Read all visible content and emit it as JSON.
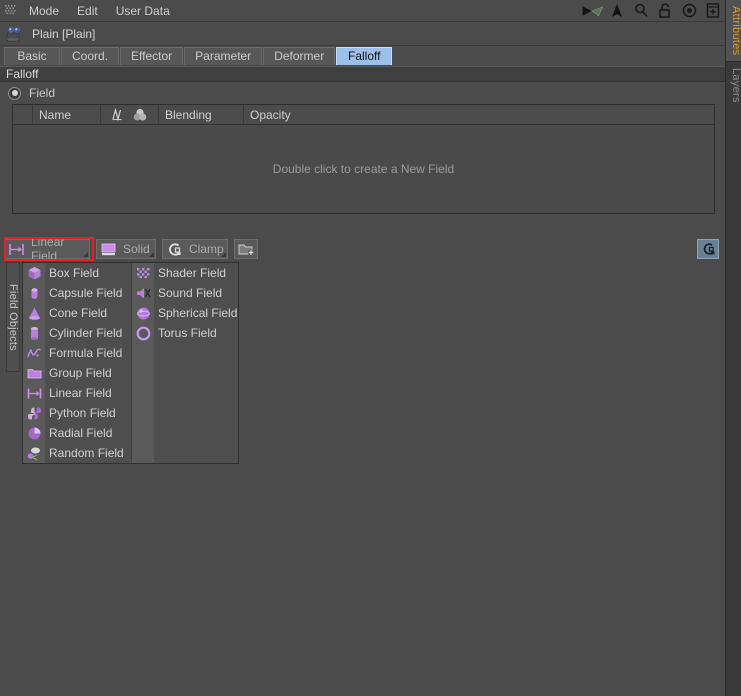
{
  "window": {
    "app": "Cinema 4D Attributes Manager",
    "background_color": "#4b4b4b",
    "accent_color": "#b07ad6",
    "highlight_color": "#ee1c25",
    "active_tab_color": "#9dc0ea"
  },
  "menubar": {
    "grip_icon": "grip-dots-icon",
    "items": [
      {
        "label": "Mode"
      },
      {
        "label": "Edit"
      },
      {
        "label": "User Data"
      }
    ],
    "tools": [
      {
        "name": "navigate-back-icon",
        "glyph": "◀"
      },
      {
        "name": "perspective-view-icon",
        "glyph": "▶"
      },
      {
        "name": "pointer-arrow-icon",
        "glyph": "▲"
      },
      {
        "name": "search-icon",
        "glyph": "⚲"
      },
      {
        "name": "lock-open-icon",
        "glyph": "⚿"
      },
      {
        "name": "target-icon",
        "glyph": "◎"
      },
      {
        "name": "new-panel-icon",
        "glyph": "⊞"
      }
    ]
  },
  "object": {
    "icon": "plain-effector-icon",
    "title": "Plain [Plain]"
  },
  "tabs": [
    {
      "label": "Basic",
      "active": false
    },
    {
      "label": "Coord.",
      "active": false
    },
    {
      "label": "Effector",
      "active": false
    },
    {
      "label": "Parameter",
      "active": false
    },
    {
      "label": "Deformer",
      "active": false
    },
    {
      "label": "Falloff",
      "active": true
    }
  ],
  "section": {
    "title": "Falloff",
    "field_row_label": "Field",
    "field_radio_icon": "radio-selected-icon"
  },
  "field_list": {
    "columns": [
      {
        "key": "enable",
        "label": ""
      },
      {
        "key": "name",
        "label": "Name"
      },
      {
        "key": "mode",
        "label": "",
        "icons": [
          "curve-icon",
          "color-blend-icon"
        ]
      },
      {
        "key": "blending",
        "label": "Blending"
      },
      {
        "key": "opacity",
        "label": "Opacity"
      }
    ],
    "rows": [],
    "empty_message": "Double click to create a New Field"
  },
  "toolbar": {
    "buttons": [
      {
        "label": "Linear Field",
        "icon": "linear-field-icon",
        "highlighted": true
      },
      {
        "label": "Solid",
        "icon": "solid-layer-icon",
        "highlighted": false
      },
      {
        "label": "Clamp",
        "icon": "clamp-layer-icon",
        "highlighted": false
      }
    ],
    "add_folder_icon": "add-folder-icon",
    "right_button_icon": "remap-icon"
  },
  "field_objects_strip": {
    "label": "Field Objects"
  },
  "popup_menu": {
    "left_column": [
      {
        "label": "Box Field",
        "icon": "box-field-icon"
      },
      {
        "label": "Capsule Field",
        "icon": "capsule-field-icon"
      },
      {
        "label": "Cone Field",
        "icon": "cone-field-icon"
      },
      {
        "label": "Cylinder Field",
        "icon": "cylinder-field-icon"
      },
      {
        "label": "Formula Field",
        "icon": "formula-field-icon"
      },
      {
        "label": "Group Field",
        "icon": "group-field-icon"
      },
      {
        "label": "Linear Field",
        "icon": "linear-field-icon"
      },
      {
        "label": "Python Field",
        "icon": "python-field-icon"
      },
      {
        "label": "Radial Field",
        "icon": "radial-field-icon"
      },
      {
        "label": "Random Field",
        "icon": "random-field-icon"
      }
    ],
    "right_column": [
      {
        "label": "Shader Field",
        "icon": "shader-field-icon"
      },
      {
        "label": "Sound Field",
        "icon": "sound-field-icon"
      },
      {
        "label": "Spherical Field",
        "icon": "spherical-field-icon"
      },
      {
        "label": "Torus Field",
        "icon": "torus-field-icon"
      }
    ]
  },
  "side_tabs": [
    {
      "label": "Attributes",
      "active": true
    },
    {
      "label": "Layers",
      "active": false
    }
  ]
}
